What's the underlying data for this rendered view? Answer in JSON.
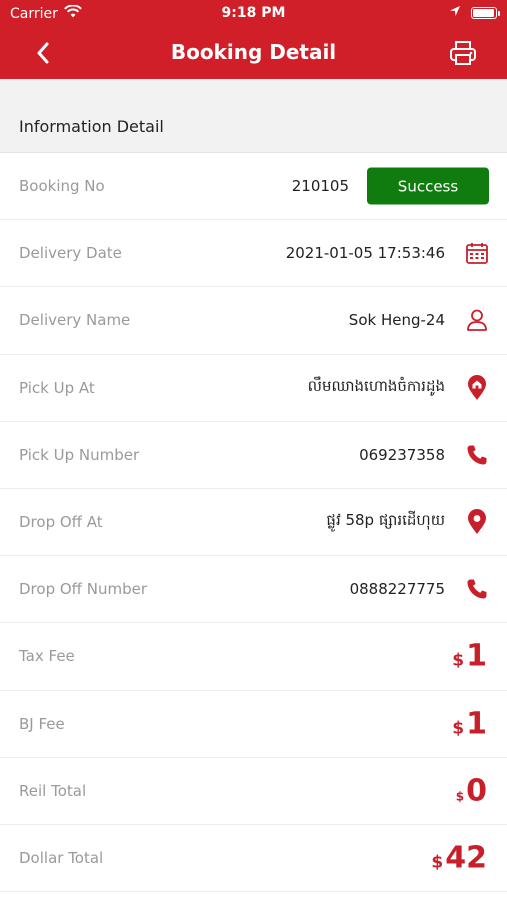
{
  "status_bar": {
    "carrier": "Carrier",
    "time": "9:18 PM",
    "battery_level": 0.95
  },
  "nav": {
    "title": "Booking Detail",
    "back_icon": "chevron-left-icon",
    "print_icon": "printer-icon"
  },
  "section": {
    "title": "Information Detail"
  },
  "booking": {
    "label": "Booking No",
    "value": "210105",
    "status": "Success"
  },
  "rows": [
    {
      "label": "Delivery Date",
      "value": "2021-01-05 17:53:46",
      "icon": "calendar-icon"
    },
    {
      "label": "Delivery Name",
      "value": "Sok Heng-24",
      "icon": "user-icon"
    },
    {
      "label": "Pick Up At",
      "value": "លឹមឈាងហោងចំការដូង",
      "icon": "home-pin-icon"
    },
    {
      "label": "Pick Up Number",
      "value": "069237358",
      "icon": "phone-icon"
    },
    {
      "label": "Drop Off At",
      "value": "ផ្លូវ 58p ផ្សារដើហុយ",
      "icon": "location-pin-icon"
    },
    {
      "label": "Drop Off Number",
      "value": "0888227775",
      "icon": "phone-icon"
    }
  ],
  "fees": [
    {
      "label": "Tax Fee",
      "symbol": "$",
      "amount": "1"
    },
    {
      "label": "BJ Fee",
      "symbol": "$",
      "amount": "1"
    },
    {
      "label": "Reil Total",
      "symbol": "$",
      "amount": "0"
    },
    {
      "label": "Dollar Total",
      "symbol": "$",
      "amount": "42"
    }
  ],
  "colors": {
    "brand": "#d01f28",
    "success": "#107c10",
    "accent": "#c8202a"
  }
}
